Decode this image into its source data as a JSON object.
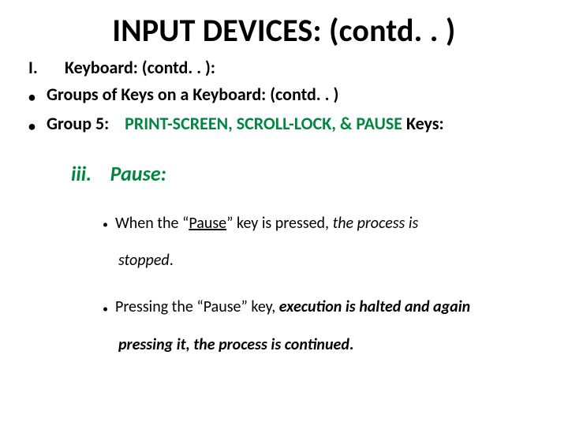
{
  "title": "INPUT DEVICES: (contd. . )",
  "line1_marker": "I.",
  "line1_text": "Keyboard: (contd. . ):",
  "line2_text": "Groups of Keys on a Keyboard: (contd. . )",
  "group5_label": "Group 5:",
  "group5_green": "PRINT-SCREEN, SCROLL-LOCK, & PAUSE",
  "group5_tail": " Keys:",
  "pause_marker": "iii.",
  "pause_label": "Pause:",
  "b1_pre": "When the “",
  "b1_pause": "Pause",
  "b1_mid": "” key is pressed, ",
  "b1_italic1": "the process is",
  "b1_italic2": "stopped",
  "b1_period": ".",
  "b2_pre": "Pressing the “Pause” key, ",
  "b2_bi1": "execution is halted and again",
  "b2_bi2": "pressing it, the process is continued",
  "b2_period": "."
}
